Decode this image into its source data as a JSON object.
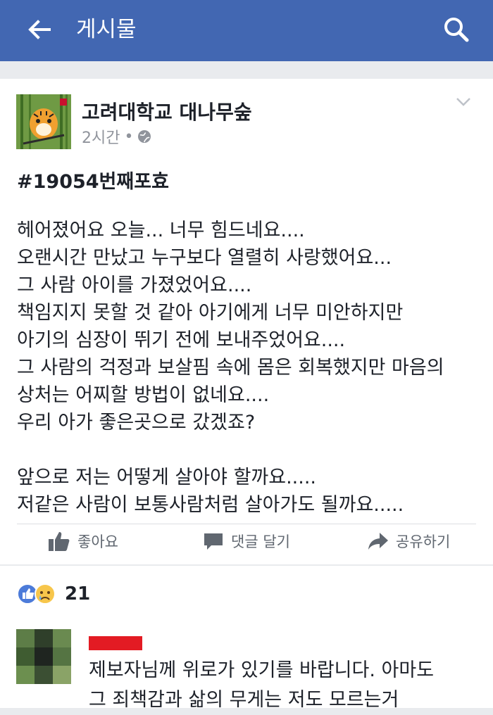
{
  "appbar": {
    "title": "게시물",
    "back_icon": "arrow-left-icon",
    "search_icon": "search-icon",
    "color": "#4267b2"
  },
  "post": {
    "author": "고려대학교 대나무숲",
    "time": "2시간",
    "separator": "•",
    "privacy_icon": "globe-icon",
    "hashtag": "#19054번째포효",
    "lines": [
      "헤어졌어요 오늘... 너무 힘드네요....",
      "오랜시간 만났고 누구보다 열렬히 사랑했어요...",
      "그 사람 아이를 가졌었어요....",
      "책임지지 못할 것 같아 아기에게 너무 미안하지만",
      "아기의 심장이 뛰기 전에 보내주었어요....",
      "그 사람의 걱정과 보살핌 속에 몸은 회복했지만 마음의",
      "상처는 어찌할 방법이 없네요....",
      "우리 아가 좋은곳으로 갔겠죠?",
      "",
      "앞으로 저는 어떻게 살아야 할까요.....",
      "저같은 사람이 보통사람처럼 살아가도 될까요....."
    ],
    "actions": {
      "like": "좋아요",
      "comment": "댓글 달기",
      "share": "공유하기"
    }
  },
  "reactions": {
    "count": "21",
    "icons": [
      "like-reaction-icon",
      "sad-reaction-icon"
    ]
  },
  "comment": {
    "lines": [
      "제보자님께 위로가 있기를 바랍니다. 아마도",
      "그 죄책감과 삶의 무게는   저도 모르는거"
    ]
  }
}
